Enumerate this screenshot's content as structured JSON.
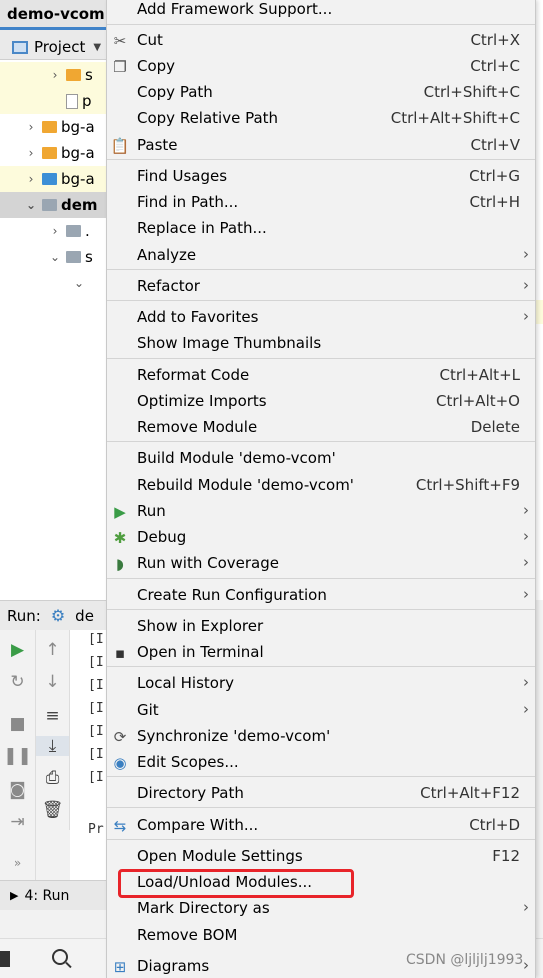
{
  "ide": {
    "tab_title": "demo-vcom",
    "project_label": "Project",
    "tree": [
      {
        "label": "s",
        "icon": "folder-orange-icon"
      },
      {
        "label": "p",
        "icon": "file-icon"
      },
      {
        "label": "bg-a",
        "icon": "folder-orange-icon"
      },
      {
        "label": "bg-a",
        "icon": "folder-orange-icon"
      },
      {
        "label": "bg-a",
        "icon": "folder-blue-icon"
      },
      {
        "label": "dem",
        "icon": "folder-grey-icon"
      },
      {
        "label": ".",
        "icon": "folder-grey-icon"
      },
      {
        "label": "s",
        "icon": "folder-grey-icon"
      }
    ],
    "run_label": "Run:",
    "run_tab": "de",
    "console_lines": [
      "[I",
      "[I",
      "[I",
      "[I",
      "[I",
      "[I",
      "[I",
      "Pr"
    ],
    "bottom_run_label": "4: Run",
    "watermark": "CSDN @ljljlj1993"
  },
  "menu": {
    "items": [
      {
        "label": "Add Framework Support...",
        "shortcut": "",
        "submenu": false,
        "icon": ""
      },
      {
        "label": "Cut",
        "shortcut": "Ctrl+X",
        "submenu": false,
        "icon": "scissors-icon"
      },
      {
        "label": "Copy",
        "shortcut": "Ctrl+C",
        "submenu": false,
        "icon": "copy-icon"
      },
      {
        "label": "Copy Path",
        "shortcut": "Ctrl+Shift+C",
        "submenu": false,
        "icon": ""
      },
      {
        "label": "Copy Relative Path",
        "shortcut": "Ctrl+Alt+Shift+C",
        "submenu": false,
        "icon": ""
      },
      {
        "label": "Paste",
        "shortcut": "Ctrl+V",
        "submenu": false,
        "icon": "paste-icon"
      },
      {
        "label": "Find Usages",
        "shortcut": "Ctrl+G",
        "submenu": false,
        "icon": ""
      },
      {
        "label": "Find in Path...",
        "shortcut": "Ctrl+H",
        "submenu": false,
        "icon": ""
      },
      {
        "label": "Replace in Path...",
        "shortcut": "",
        "submenu": false,
        "icon": ""
      },
      {
        "label": "Analyze",
        "shortcut": "",
        "submenu": true,
        "icon": ""
      },
      {
        "label": "Refactor",
        "shortcut": "",
        "submenu": true,
        "icon": ""
      },
      {
        "label": "Add to Favorites",
        "shortcut": "",
        "submenu": true,
        "icon": ""
      },
      {
        "label": "Show Image Thumbnails",
        "shortcut": "",
        "submenu": false,
        "icon": ""
      },
      {
        "label": "Reformat Code",
        "shortcut": "Ctrl+Alt+L",
        "submenu": false,
        "icon": ""
      },
      {
        "label": "Optimize Imports",
        "shortcut": "Ctrl+Alt+O",
        "submenu": false,
        "icon": ""
      },
      {
        "label": "Remove Module",
        "shortcut": "Delete",
        "submenu": false,
        "icon": ""
      },
      {
        "label": "Build Module 'demo-vcom'",
        "shortcut": "",
        "submenu": false,
        "icon": ""
      },
      {
        "label": "Rebuild Module 'demo-vcom'",
        "shortcut": "Ctrl+Shift+F9",
        "submenu": false,
        "icon": ""
      },
      {
        "label": "Run",
        "shortcut": "",
        "submenu": true,
        "icon": "run-icon"
      },
      {
        "label": "Debug",
        "shortcut": "",
        "submenu": true,
        "icon": "debug-icon"
      },
      {
        "label": "Run with Coverage",
        "shortcut": "",
        "submenu": true,
        "icon": "coverage-icon"
      },
      {
        "label": "Create Run Configuration",
        "shortcut": "",
        "submenu": true,
        "icon": ""
      },
      {
        "label": "Show in Explorer",
        "shortcut": "",
        "submenu": false,
        "icon": ""
      },
      {
        "label": "Open in Terminal",
        "shortcut": "",
        "submenu": false,
        "icon": "terminal-icon"
      },
      {
        "label": "Local History",
        "shortcut": "",
        "submenu": true,
        "icon": ""
      },
      {
        "label": "Git",
        "shortcut": "",
        "submenu": true,
        "icon": ""
      },
      {
        "label": "Synchronize 'demo-vcom'",
        "shortcut": "",
        "submenu": false,
        "icon": "sync-icon"
      },
      {
        "label": "Edit Scopes...",
        "shortcut": "",
        "submenu": false,
        "icon": "scopes-icon"
      },
      {
        "label": "Directory Path",
        "shortcut": "Ctrl+Alt+F12",
        "submenu": false,
        "icon": ""
      },
      {
        "label": "Compare With...",
        "shortcut": "Ctrl+D",
        "submenu": false,
        "icon": "compare-icon"
      },
      {
        "label": "Open Module Settings",
        "shortcut": "F12",
        "submenu": false,
        "icon": ""
      },
      {
        "label": "Load/Unload Modules...",
        "shortcut": "",
        "submenu": false,
        "icon": ""
      },
      {
        "label": "Mark Directory as",
        "shortcut": "",
        "submenu": true,
        "icon": ""
      },
      {
        "label": "Remove BOM",
        "shortcut": "",
        "submenu": false,
        "icon": ""
      },
      {
        "label": "Diagrams",
        "shortcut": "",
        "submenu": true,
        "icon": "diagrams-icon"
      }
    ],
    "highlighted_item": "Load/Unload Modules...",
    "highlight_color": "#e8242a"
  }
}
